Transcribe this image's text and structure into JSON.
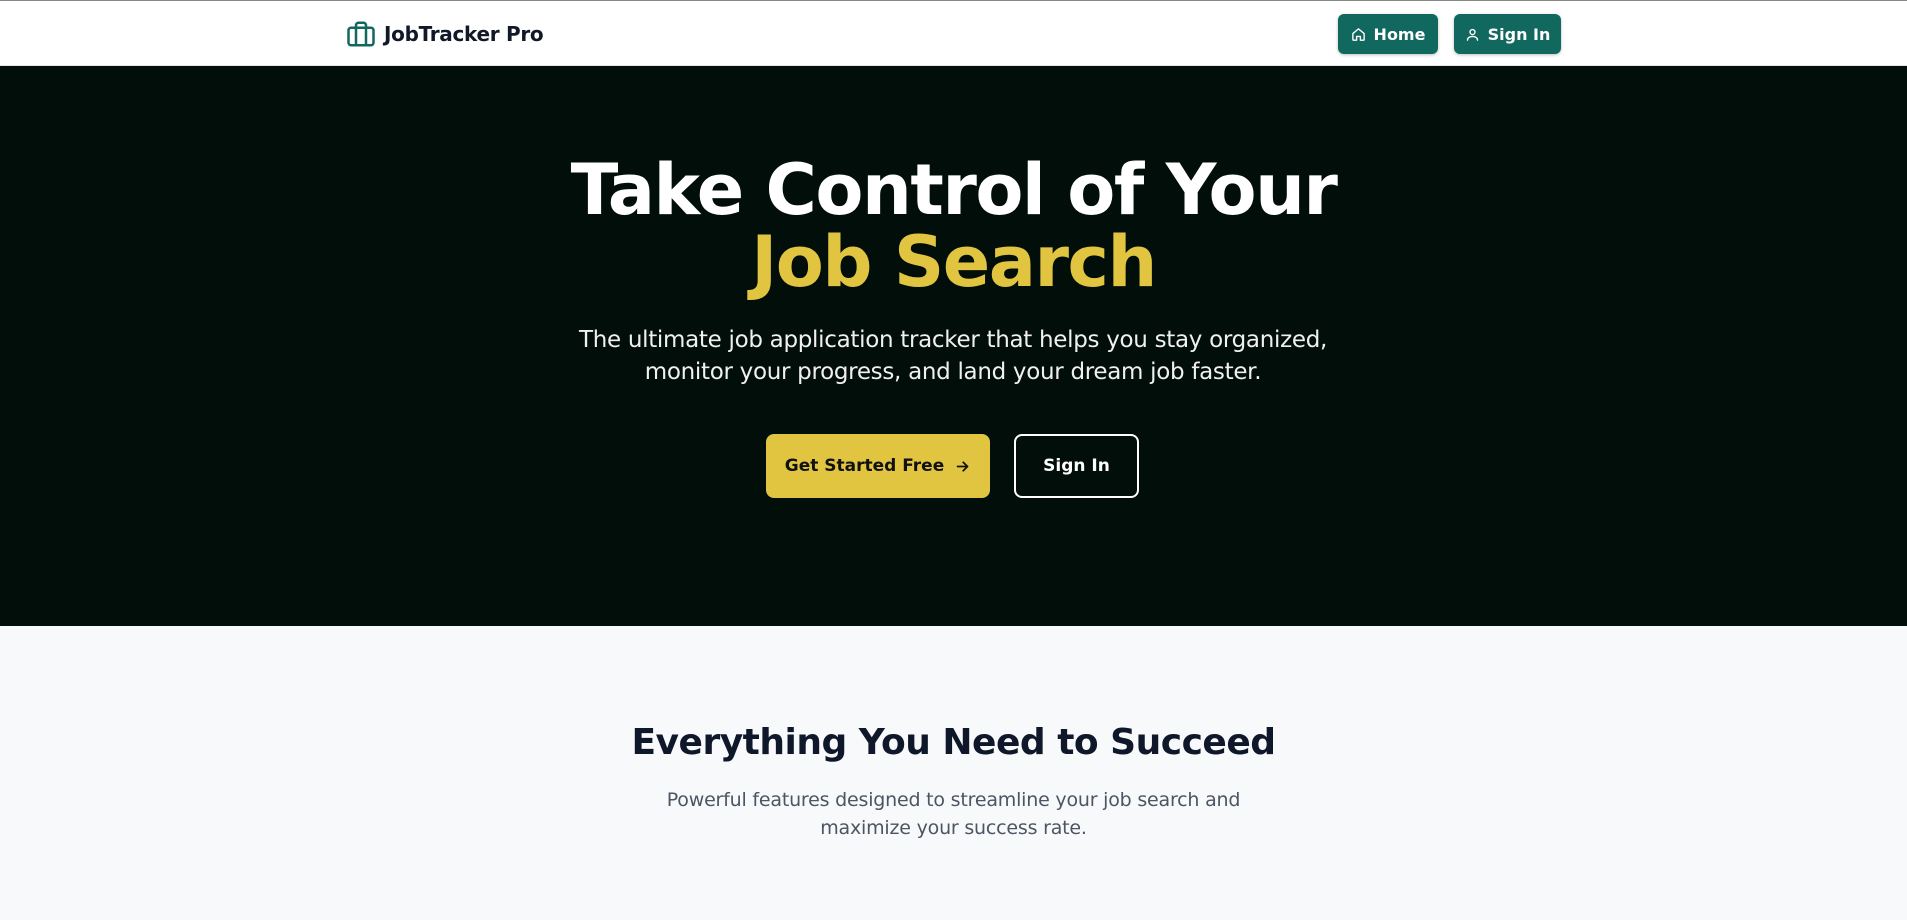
{
  "colors": {
    "brand_teal": "#11685e",
    "accent_yellow": "#e1c540",
    "hero_background": "#020e0a",
    "section_background": "#f8f9fb",
    "heading_dark": "#0f172a"
  },
  "navbar": {
    "brand_icon": "briefcase-icon",
    "brand_name": "JobTracker Pro",
    "home_button": {
      "icon": "home-icon",
      "label": "Home"
    },
    "signin_button": {
      "icon": "user-icon",
      "label": "Sign In"
    }
  },
  "hero": {
    "title_line1": "Take Control of Your",
    "title_line2": "Job Search",
    "subtitle": "The ultimate job application tracker that helps you stay organized, monitor your progress, and land your dream job faster.",
    "primary_cta": {
      "label": "Get Started Free",
      "icon": "arrow-right-icon"
    },
    "secondary_cta": {
      "label": "Sign In"
    }
  },
  "features": {
    "title": "Everything You Need to Succeed",
    "subtitle": "Powerful features designed to streamline your job search and maximize your success rate."
  }
}
